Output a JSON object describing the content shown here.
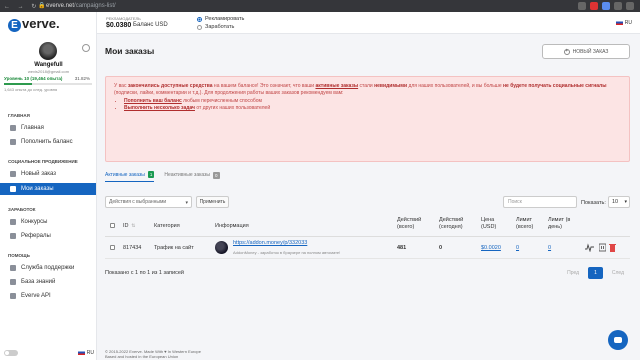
{
  "browser": {
    "nav": "← → ↻",
    "url_host": "everve.net",
    "url_path": "/campaigns-list/"
  },
  "sidebar": {
    "logo": "verve.",
    "logo_letter": "E",
    "user": {
      "name": "Wangefull",
      "email": "wevis2018@gmail.com",
      "level": "Уровень 10 (19,464 опыта)",
      "level_pct": "31.82%",
      "level_progress": 0.3182,
      "level_note": "1,643 опыта до след. уровня"
    },
    "sections": [
      {
        "title": "ГЛАВНАЯ",
        "items": [
          {
            "label": "Главная",
            "active": false
          },
          {
            "label": "Пополнить баланс",
            "active": false
          }
        ]
      },
      {
        "title": "СОЦИАЛЬНОЕ ПРОДВИЖЕНИЕ",
        "items": [
          {
            "label": "Новый заказ",
            "active": false
          },
          {
            "label": "Мои заказы",
            "active": true
          }
        ]
      },
      {
        "title": "ЗАРАБОТОК",
        "items": [
          {
            "label": "Конкурсы",
            "active": false
          },
          {
            "label": "Рефералы",
            "active": false
          }
        ]
      },
      {
        "title": "ПОМОЩЬ",
        "items": [
          {
            "label": "Служба поддержки",
            "active": false
          },
          {
            "label": "База знаний",
            "active": false
          },
          {
            "label": "Everve API",
            "active": false
          }
        ]
      }
    ],
    "lang": "RU"
  },
  "topbar": {
    "balance_label": "РЕКЛАМОДАТЕЛЬ",
    "balance_value": "$0.0380",
    "balance_currency": "Баланс USD",
    "mode_advertise": "Рекламировать",
    "mode_earn": "Заработать",
    "lang": "RU"
  },
  "main": {
    "title": "Мои заказы",
    "new_order": "НОВЫЙ ЗАКАЗ",
    "alert": {
      "p1_a": "У вас ",
      "p1_b": "закончились доступные средства",
      "p1_c": " на вашем балансе! Это означает, что ваши ",
      "p1_d": "активные заказы",
      "p1_e": " стали ",
      "p1_f": "невидимыми",
      "p1_g": " для наших пользователей, и вы больше ",
      "p1_h": "не будете получать социальные сигналы",
      "p1_i": " (подписки, лайки, комментарии и т.д.). Для продолжения работы ваших заказов рекомендуем вам:",
      "li1_a": "Пополнить ваш баланс",
      "li1_b": " любым перечисленным способом",
      "li2_a": "Выполнить несколько задач",
      "li2_b": " от других наших пользователей"
    },
    "tabs": [
      {
        "label": "Активные заказы",
        "count": "1"
      },
      {
        "label": "Неактивные заказы",
        "count": "0"
      }
    ],
    "bulk_select": "Действия с выбранными",
    "apply": "Применить",
    "search_placeholder": "Поиск",
    "show_label": "Показать:",
    "show_value": "10",
    "columns": {
      "id": "ID",
      "category": "Категория",
      "info": "Информация",
      "actions_total": "Действий (всего)",
      "actions_today": "Действий (сегодня)",
      "price": "Цена (USD)",
      "limit_total": "Лимит (всего)",
      "limit_day": "Лимит (в день)"
    },
    "rows": [
      {
        "id": "817434",
        "category": "Трафик на сайт",
        "url": "https://addon.money/p/332033",
        "desc": "AddonMoney - заработок в браузере на полном автомате!",
        "actions_total": "481",
        "actions_today": "0",
        "price": "$0.0020",
        "limit_total": "0",
        "limit_day": "0"
      }
    ],
    "pager_info": "Показано с 1 по 1 из 1 записей",
    "pager": {
      "prev": "Пред",
      "page": "1",
      "next": "След"
    },
    "footer_1": "© 2015-2022 Everve. Made With ♥ In Western Europe",
    "footer_2": "Based and hosted in the European Union"
  }
}
